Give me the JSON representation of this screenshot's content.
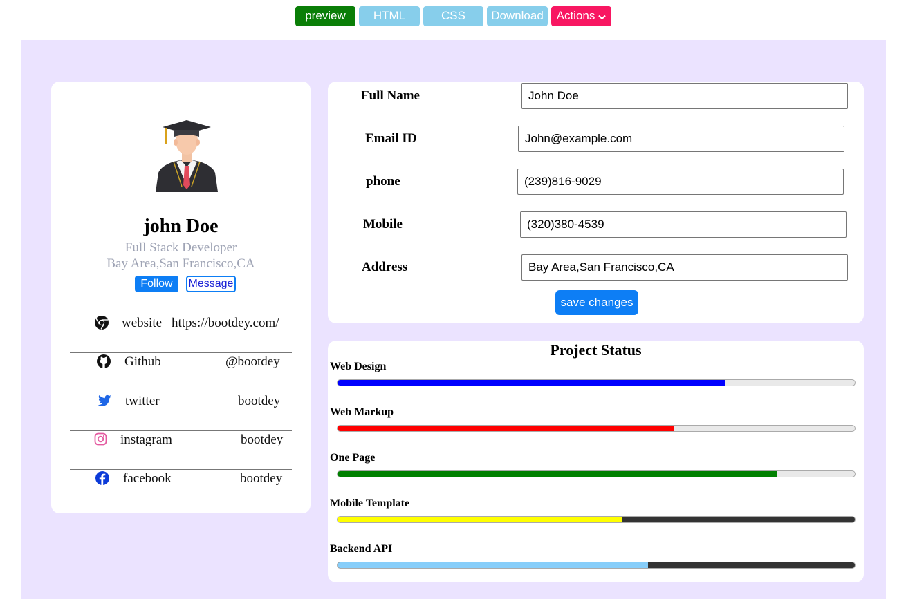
{
  "toolbar": {
    "buttons": [
      {
        "label": "preview",
        "color": "#0a7e07"
      },
      {
        "label": "HTML",
        "color": "#87ceeb"
      },
      {
        "label": "CSS",
        "color": "#87ceeb"
      },
      {
        "label": "Download",
        "color": "#87ceeb"
      },
      {
        "label": "Actions",
        "color": "#f81762"
      }
    ]
  },
  "profile": {
    "avatar_icon": "graduate-avatar-icon",
    "name": "john Doe",
    "role": "Full Stack Developer",
    "location": "Bay Area,San Francisco,CA",
    "follow_label": "Follow",
    "message_label": "Message",
    "links": [
      {
        "icon": "chrome-icon",
        "label": "website",
        "value": "https://bootdey.com/"
      },
      {
        "icon": "github-icon",
        "label": "Github",
        "value": "@bootdey"
      },
      {
        "icon": "twitter-icon",
        "label": "twitter",
        "value": "bootdey"
      },
      {
        "icon": "instagram-icon",
        "label": "instagram",
        "value": "bootdey"
      },
      {
        "icon": "facebook-icon",
        "label": "facebook",
        "value": "bootdey"
      }
    ]
  },
  "form": {
    "fields": [
      {
        "label": "Full Name",
        "value": "John Doe"
      },
      {
        "label": "Email ID",
        "value": "John@example.com"
      },
      {
        "label": "phone",
        "value": "(239)816-9029"
      },
      {
        "label": "Mobile",
        "value": "(320)380-4539"
      },
      {
        "label": "Address",
        "value": "Bay Area,San Francisco,CA"
      }
    ],
    "save_label": "save changes"
  },
  "project_status": {
    "title": "Project Status",
    "items": [
      {
        "label": "Web Design",
        "progress": 0.75,
        "color": "#0000ff",
        "track": "#e9e9e9"
      },
      {
        "label": "Web Markup",
        "progress": 0.65,
        "color": "#ff0000",
        "track": "#e9e9e9"
      },
      {
        "label": "One Page",
        "progress": 0.85,
        "color": "#008000",
        "track": "#e9e9e9"
      },
      {
        "label": "Mobile Template",
        "progress": 0.55,
        "color": "#ffff00",
        "track": "#333333"
      },
      {
        "label": "Backend API",
        "progress": 0.6,
        "color": "#87cefa",
        "track": "#333333"
      }
    ]
  },
  "colors": {
    "background": "#ebe3ff",
    "primary": "#0d7ef5",
    "muted_text": "#9fa4b5"
  }
}
